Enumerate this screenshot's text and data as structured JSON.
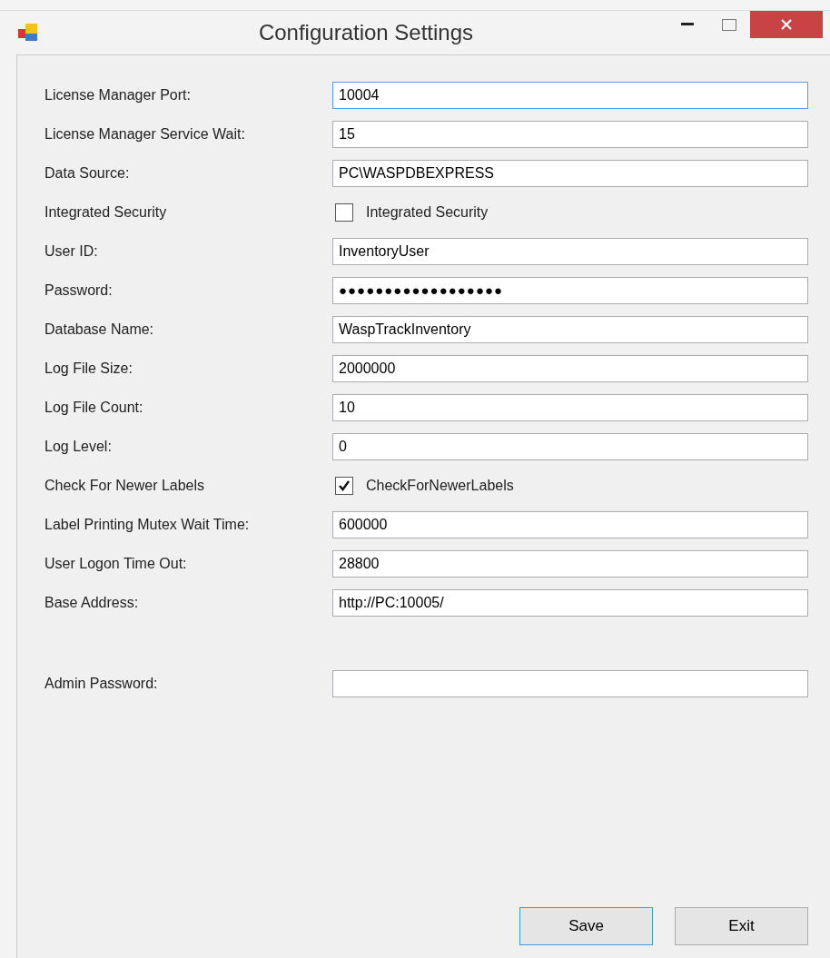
{
  "window": {
    "title": "Configuration Settings"
  },
  "fields": [
    {
      "kind": "text",
      "label": "License Manager Port:",
      "value": "10004",
      "focused": true
    },
    {
      "kind": "text",
      "label": "License Manager Service Wait:",
      "value": "15",
      "focused": false
    },
    {
      "kind": "text",
      "label": "Data Source:",
      "value": "PC\\WASPDBEXPRESS",
      "focused": false
    },
    {
      "kind": "checkbox",
      "label": "Integrated Security",
      "caption": "Integrated Security",
      "checked": false
    },
    {
      "kind": "text",
      "label": "User ID:",
      "value": "InventoryUser",
      "focused": false
    },
    {
      "kind": "password",
      "label": "Password:",
      "value": "●●●●●●●●●●●●●●●●●●",
      "focused": false
    },
    {
      "kind": "text",
      "label": "Database Name:",
      "value": "WaspTrackInventory",
      "focused": false
    },
    {
      "kind": "text",
      "label": "Log File Size:",
      "value": "2000000",
      "focused": false
    },
    {
      "kind": "text",
      "label": "Log File Count:",
      "value": "10",
      "focused": false
    },
    {
      "kind": "text",
      "label": "Log Level:",
      "value": "0",
      "focused": false
    },
    {
      "kind": "checkbox",
      "label": "Check For Newer Labels",
      "caption": "CheckForNewerLabels",
      "checked": true
    },
    {
      "kind": "text",
      "label": "Label Printing Mutex Wait Time:",
      "value": "600000",
      "focused": false
    },
    {
      "kind": "text",
      "label": "User Logon Time Out:",
      "value": "28800",
      "focused": false
    },
    {
      "kind": "text",
      "label": "Base Address:",
      "value": "http://PC:10005/",
      "focused": false
    }
  ],
  "admin": {
    "label": "Admin Password:"
  },
  "buttons": [
    {
      "label": "Save",
      "default": true
    },
    {
      "label": "Exit",
      "default": false
    }
  ]
}
